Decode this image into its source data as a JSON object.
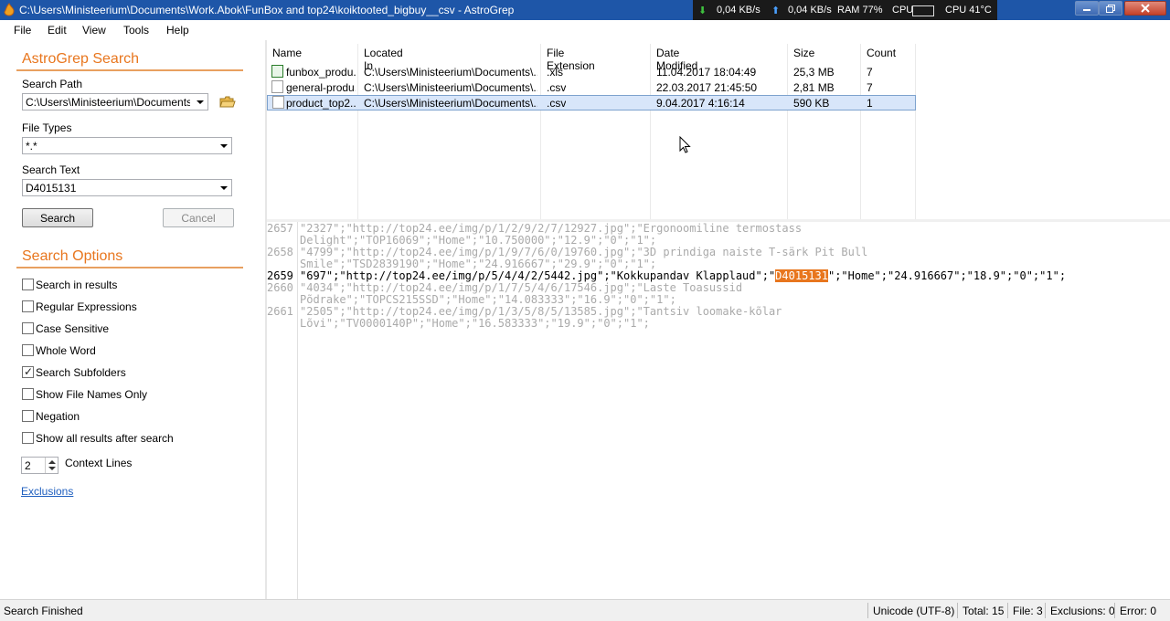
{
  "window": {
    "title": "C:\\Users\\Ministeerium\\Documents\\Work.Abok\\FunBox and top24\\koiktooted_bigbuy__csv - AstroGrep"
  },
  "sysmon": {
    "down": "0,04 KB/s",
    "up": "0,04 KB/s",
    "ram": "RAM 77%",
    "cpu_label": "CPU",
    "cpu_temp": "CPU 41°C"
  },
  "menu": [
    "File",
    "Edit",
    "View",
    "Tools",
    "Help"
  ],
  "search": {
    "heading": "AstroGrep Search",
    "path_label": "Search Path",
    "path_value": "C:\\Users\\Ministeerium\\Documents\\Wo",
    "types_label": "File Types",
    "types_value": "*.*",
    "text_label": "Search Text",
    "text_value": "D4015131",
    "search_button": "Search",
    "cancel_button": "Cancel"
  },
  "options": {
    "heading": "Search Options",
    "items": [
      {
        "label": "Search in results",
        "checked": false
      },
      {
        "label": "Regular Expressions",
        "checked": false
      },
      {
        "label": "Case Sensitive",
        "checked": false
      },
      {
        "label": "Whole Word",
        "checked": false
      },
      {
        "label": "Search Subfolders",
        "checked": true
      },
      {
        "label": "Show File Names Only",
        "checked": false
      },
      {
        "label": "Negation",
        "checked": false
      },
      {
        "label": "Show all results after search",
        "checked": false
      }
    ],
    "context_value": "2",
    "context_label": "Context Lines",
    "exclusions_link": "Exclusions"
  },
  "results": {
    "columns": [
      "Name",
      "Located In",
      "File Extension",
      "Date Modified",
      "Size",
      "Count"
    ],
    "rows": [
      {
        "name": "funbox_produ...",
        "location": "C:\\Users\\Ministeerium\\Documents\\...",
        "ext": ".xls",
        "date": "11.04.2017 18:04:49",
        "size": "25,3 MB",
        "count": "7"
      },
      {
        "name": "general-produ...",
        "location": "C:\\Users\\Ministeerium\\Documents\\...",
        "ext": ".csv",
        "date": "22.03.2017 21:45:50",
        "size": "2,81 MB",
        "count": "7"
      },
      {
        "name": "product_top2...",
        "location": "C:\\Users\\Ministeerium\\Documents\\...",
        "ext": ".csv",
        "date": "9.04.2017 4:16:14",
        "size": "590 KB",
        "count": "1"
      }
    ]
  },
  "preview": {
    "lines": [
      {
        "num": "2657",
        "text": "\"2327\";\"http://top24.ee/img/p/1/2/9/2/7/12927.jpg\";\"Ergonoomiline termostass",
        "dim": true
      },
      {
        "num": "",
        "text": "Delight\";\"TOP16069\";\"Home\";\"10.750000\";\"12.9\";\"0\";\"1\";",
        "dim": true
      },
      {
        "num": "2658",
        "text": "\"4799\";\"http://top24.ee/img/p/1/9/7/6/0/19760.jpg\";\"3D prindiga naiste T-särk Pit Bull",
        "dim": true
      },
      {
        "num": "",
        "text": "Smile\";\"TSD2839190\";\"Home\";\"24.916667\";\"29.9\";\"0\";\"1\";",
        "dim": true
      },
      {
        "num": "2660",
        "text": "\"4034\";\"http://top24.ee/img/p/1/7/5/4/6/17546.jpg\";\"Laste Toasussid",
        "dim": true
      },
      {
        "num": "",
        "text": "Põdrake\";\"TOPCS215SSD\";\"Home\";\"14.083333\";\"16.9\";\"0\";\"1\";",
        "dim": true
      },
      {
        "num": "2661",
        "text": "\"2505\";\"http://top24.ee/img/p/1/3/5/8/5/13585.jpg\";\"Tantsiv loomake-kõlar",
        "dim": true
      },
      {
        "num": "",
        "text": "Lõvi\";\"TV0000140P\";\"Home\";\"16.583333\";\"19.9\";\"0\";\"1\";",
        "dim": true
      }
    ],
    "match": {
      "num": "2659",
      "before": "\"697\";\"http://top24.ee/img/p/5/4/4/2/5442.jpg\";\"Kokkupandav Klapplaud\";\"",
      "hit": "D4015131",
      "after": "\";\"Home\";\"24.916667\";\"18.9\";\"0\";\"1\";"
    }
  },
  "status": {
    "message": "Search Finished",
    "encoding": "Unicode (UTF-8)",
    "total": "Total: 15",
    "file": "File: 3",
    "exclusions": "Exclusions: 0",
    "error": "Error: 0"
  }
}
